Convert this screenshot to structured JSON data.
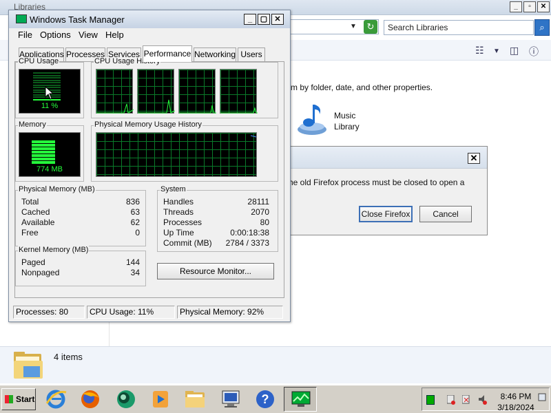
{
  "explorer": {
    "window_title": "Libraries",
    "search_placeholder": "Search Libraries",
    "description": "m by folder, date, and other properties.",
    "music_library": {
      "line1": "Music",
      "line2": "Library"
    },
    "items_count": "4 items"
  },
  "firefox_dialog": {
    "message": "he old Firefox process must be closed to open a",
    "close_firefox_label": "Close Firefox",
    "cancel_label": "Cancel",
    "close_glyph": "✕"
  },
  "task_manager": {
    "title": "Windows Task Manager",
    "menu": [
      "File",
      "Options",
      "View",
      "Help"
    ],
    "tabs": [
      "Applications",
      "Processes",
      "Services",
      "Performance",
      "Networking",
      "Users"
    ],
    "active_tab": "Performance",
    "cpu_usage": {
      "label": "CPU Usage",
      "value": "11 %",
      "percent": 11
    },
    "cpu_history": {
      "label": "CPU Usage History"
    },
    "memory": {
      "label": "Memory",
      "value": "774 MB",
      "fraction": 0.92
    },
    "memory_history": {
      "label": "Physical Memory Usage History"
    },
    "physical_memory": {
      "label": "Physical Memory (MB)",
      "rows": [
        {
          "label": "Total",
          "value": "836"
        },
        {
          "label": "Cached",
          "value": "63"
        },
        {
          "label": "Available",
          "value": "62"
        },
        {
          "label": "Free",
          "value": "0"
        }
      ]
    },
    "kernel_memory": {
      "label": "Kernel Memory (MB)",
      "rows": [
        {
          "label": "Paged",
          "value": "144"
        },
        {
          "label": "Nonpaged",
          "value": "34"
        }
      ]
    },
    "system": {
      "label": "System",
      "rows": [
        {
          "label": "Handles",
          "value": "28111"
        },
        {
          "label": "Threads",
          "value": "2070"
        },
        {
          "label": "Processes",
          "value": "80"
        },
        {
          "label": "Up Time",
          "value": "0:00:18:38"
        },
        {
          "label": "Commit (MB)",
          "value": "2784 / 3373"
        }
      ]
    },
    "resource_monitor_label": "Resource Monitor...",
    "status": {
      "processes": "Processes: 80",
      "cpu": "CPU Usage: 11%",
      "memory": "Physical Memory: 92%"
    }
  },
  "taskbar": {
    "start_label": "Start",
    "clock_time": "8:46 PM",
    "clock_date": "3/18/2024"
  },
  "colors": {
    "graph_green": "#25ff3c",
    "grid_green": "#0a7a2a"
  }
}
